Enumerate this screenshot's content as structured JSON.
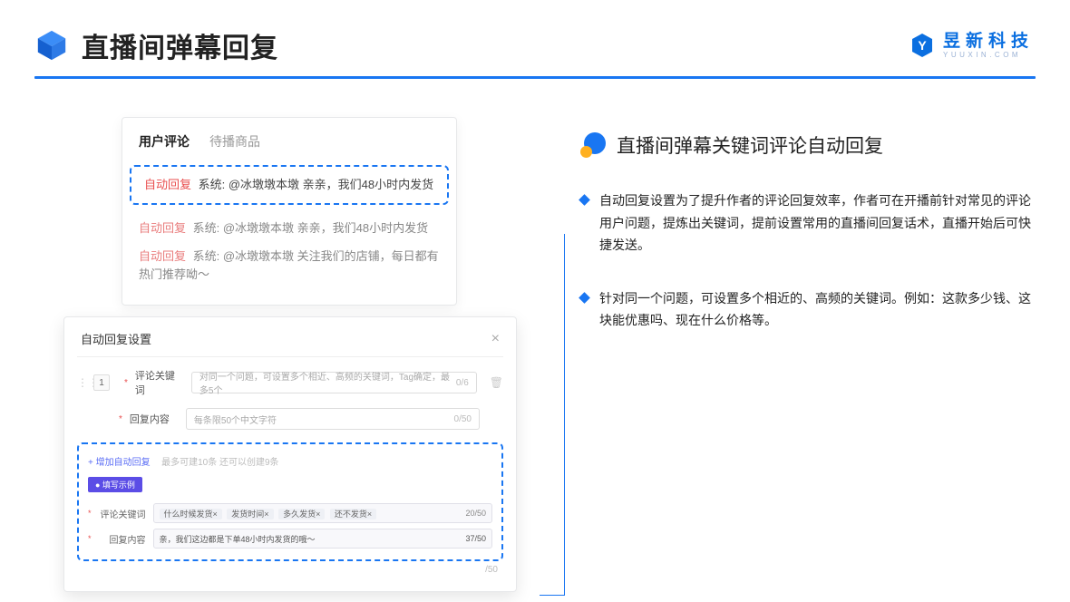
{
  "header": {
    "title": "直播间弹幕回复",
    "brand_cn": "昱新科技",
    "brand_en": "YUUXIN.COM"
  },
  "card1": {
    "tab_active": "用户评论",
    "tab_inactive": "待播商品",
    "highlight": {
      "badge": "自动回复",
      "text": "系统: @冰墩墩本墩 亲亲，我们48小时内发货"
    },
    "line2": {
      "badge": "自动回复",
      "text": "系统: @冰墩墩本墩 亲亲，我们48小时内发货"
    },
    "line3": {
      "badge": "自动回复",
      "text": "系统: @冰墩墩本墩 关注我们的店铺，每日都有热门推荐呦～"
    }
  },
  "card2": {
    "title": "自动回复设置",
    "seq": "1",
    "kw_label": "评论关键词",
    "kw_placeholder": "对同一个问题，可设置多个相近、高频的关键词，Tag确定，最多5个",
    "kw_count": "0/6",
    "content_label": "回复内容",
    "content_placeholder": "每条限50个中文字符",
    "content_count": "0/50",
    "add_link": "+ 增加自动回复",
    "add_note": "最多可建10条 还可以创建9条",
    "pill": "● 填写示例",
    "ex_kw_label": "评论关键词",
    "ex_tags": [
      "什么时候发货×",
      "发货时间×",
      "多久发货×",
      "还不发货×"
    ],
    "ex_kw_count": "20/50",
    "ex_content_label": "回复内容",
    "ex_content_value": "亲，我们这边都是下单48小时内发货的哦～",
    "ex_content_count": "37/50",
    "outer_count": "/50"
  },
  "right": {
    "subtitle": "直播间弹幕关键词评论自动回复",
    "bullet1": "自动回复设置为了提升作者的评论回复效率，作者可在开播前针对常见的评论用户问题，提炼出关键词，提前设置常用的直播间回复话术，直播开始后可快捷发送。",
    "bullet2": "针对同一个问题，可设置多个相近的、高频的关键词。例如：这款多少钱、这块能优惠吗、现在什么价格等。"
  }
}
